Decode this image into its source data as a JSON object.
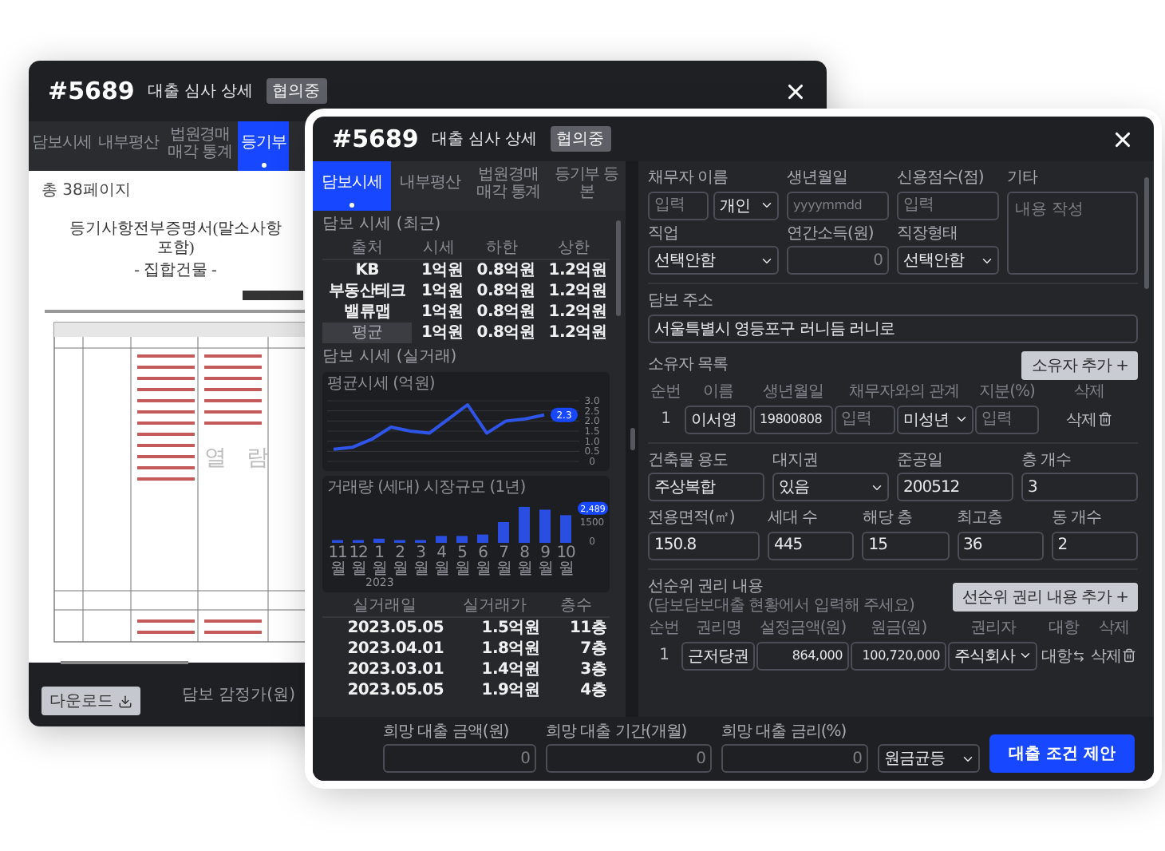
{
  "back_window": {
    "number": "#5689",
    "title": "대출 심사 상세",
    "status": "협의중",
    "tabs": [
      {
        "label": "담보시세",
        "selected": false
      },
      {
        "label": "내부평산",
        "selected": false
      },
      {
        "label": "법원경매 매각 통계",
        "selected": false
      },
      {
        "label": "등기부",
        "selected": true
      }
    ],
    "page_count": "총 38페이지",
    "document": {
      "title": "등기사항전부증명서(말소사항 포함)",
      "subtitle": "- 집합건물 -",
      "stamp": "열 람"
    },
    "download_button": "다운로드",
    "footer_label": "담보 감정가(원)"
  },
  "front_window": {
    "number": "#5689",
    "title": "대출 심사 상세",
    "status": "협의중",
    "tabs": [
      {
        "label": "담보시세",
        "selected": true
      },
      {
        "label": "내부평산",
        "selected": false
      },
      {
        "label": "법원경매 매각 통계",
        "selected": false
      },
      {
        "label": "등기부 등본",
        "selected": false
      }
    ]
  },
  "market_prices": {
    "title": "담보 시세 (최근)",
    "columns": [
      "출처",
      "시세",
      "하한",
      "상한"
    ],
    "rows": [
      {
        "kind": "source",
        "cells": [
          "KB",
          "1억원",
          "0.8억원",
          "1.2억원"
        ]
      },
      {
        "kind": "source",
        "cells": [
          "부동산테크",
          "1억원",
          "0.8억원",
          "1.2억원"
        ]
      },
      {
        "kind": "source",
        "cells": [
          "밸류맵",
          "1억원",
          "0.8억원",
          "1.2억원"
        ]
      },
      {
        "kind": "average",
        "cells": [
          "평균",
          "1억원",
          "0.8억원",
          "1.2억원"
        ]
      }
    ]
  },
  "trades": {
    "title": "담보 시세 (실거래)",
    "price_chart": {
      "current_value": "2.3",
      "chart_data": {
        "type": "line",
        "title": "평균시세 (억원)",
        "grid": true,
        "series": [
          {
            "color": "#2f55e8",
            "values": [
              0.6,
              0.7,
              1.1,
              1.7,
              1.5,
              1.4,
              2.1,
              2.8,
              1.4,
              2.0,
              2.1,
              2.3
            ]
          }
        ],
        "ylim": [
          0,
          3
        ],
        "yticks": [
          {
            "value": 0,
            "label": "0"
          },
          {
            "value": 0.5,
            "label": "0.5"
          },
          {
            "value": 1,
            "label": "1.0"
          },
          {
            "value": 1.5,
            "label": "1.5"
          },
          {
            "value": 2,
            "label": "2.0"
          },
          {
            "value": 2.5,
            "label": "2.5"
          },
          {
            "value": 3,
            "label": "3.0"
          }
        ]
      }
    },
    "volume_chart": {
      "current_value": "2,489",
      "year_label": "2023",
      "chart_data": {
        "type": "bar",
        "title": "거래량 (세대) 시장규모 (1년)",
        "categories": [
          "11월",
          "12월",
          "1월",
          "2월",
          "3월",
          "4월",
          "5월",
          "6월",
          "7월",
          "8월",
          "9월",
          "10월"
        ],
        "series": [
          {
            "color": "#2a4fe0",
            "values": [
              200,
              200,
              300,
              200,
              200,
              500,
              500,
              600,
              1500,
              2600,
              2400,
              2000
            ]
          }
        ],
        "ylim": [
          0,
          3000
        ],
        "yticks": [
          0,
          1500
        ]
      }
    },
    "table": {
      "columns": [
        "실거래일",
        "실거래가",
        "층수"
      ],
      "rows": [
        [
          "2023.05.05",
          "1.5억원",
          "11층"
        ],
        [
          "2023.04.01",
          "1.8억원",
          "7층"
        ],
        [
          "2023.03.01",
          "1.4억원",
          "3층"
        ],
        [
          "2023.05.05",
          "1.9억원",
          "4층"
        ]
      ]
    }
  },
  "borrower": {
    "name": {
      "label": "채무자 이름",
      "placeholder": "입력"
    },
    "type": {
      "value": "개인"
    },
    "birth": {
      "label": "생년월일",
      "placeholder": "yyyymmdd"
    },
    "credit": {
      "label": "신용점수(점)",
      "placeholder": "입력"
    },
    "note": {
      "label": "기타",
      "placeholder": "내용 작성"
    },
    "job": {
      "label": "직업",
      "value": "선택안함"
    },
    "income": {
      "label": "연간소득(원)",
      "placeholder": "0"
    },
    "work_type": {
      "label": "직장형태",
      "value": "선택안함"
    }
  },
  "address": {
    "label": "담보 주소",
    "value": "서울특별시 영등포구 러니듬 러니로"
  },
  "owners": {
    "title": "소유자 목록",
    "add_button": "소유자 추가 +",
    "columns": [
      "순번",
      "이름",
      "생년월일",
      "채무자와의 관계",
      "지분(%)",
      "삭제"
    ],
    "rows": [
      {
        "number": "1",
        "name": "이서영",
        "birth": "19800808",
        "relation_placeholder": "입력",
        "relation_type": "미성년",
        "share_placeholder": "입력",
        "delete": "삭제"
      }
    ]
  },
  "building": {
    "fields": [
      {
        "kind": "input",
        "label": "건축물 용도",
        "value": "주상복합"
      },
      {
        "kind": "select",
        "label": "대지권",
        "value": "있음"
      },
      {
        "kind": "input",
        "label": "준공일",
        "value": "200512"
      },
      {
        "kind": "input",
        "label": "층 개수",
        "value": "3"
      },
      {
        "kind": "input",
        "label": "전용면적(㎡)",
        "value": "150.8"
      },
      {
        "kind": "input",
        "label": "세대 수",
        "value": "445"
      },
      {
        "kind": "input",
        "label": "해당 층",
        "value": "15"
      },
      {
        "kind": "input",
        "label": "최고층",
        "value": "36"
      },
      {
        "kind": "input",
        "label": "동 개수",
        "value": "2"
      }
    ]
  },
  "prior_rights": {
    "title": "선순위 권리 내용",
    "note": "(담보담보대출 현황에서 입력해 주세요)",
    "add_button": "선순위 권리 내용 추가 +",
    "columns": [
      "순번",
      "권리명",
      "설정금액(원)",
      "원금(원)",
      "권리자",
      "대항",
      "삭제"
    ],
    "rows": [
      {
        "number": "1",
        "name": "근저당권",
        "amount": "864,000",
        "principal": "100,720,000",
        "holder": "주식회사",
        "opposable": "대항",
        "delete": "삭제"
      }
    ]
  },
  "loan_request": {
    "fields": [
      {
        "kind": "input",
        "label": "희망 대출 금액(원)",
        "placeholder": "0"
      },
      {
        "kind": "input",
        "label": "희망 대출 기간(개월)",
        "placeholder": "0"
      },
      {
        "kind": "input",
        "label": "희망 대출 금리(%)",
        "placeholder": "0"
      },
      {
        "kind": "select",
        "value": "원금균등"
      }
    ],
    "submit_button": "대출 조건 제안"
  }
}
